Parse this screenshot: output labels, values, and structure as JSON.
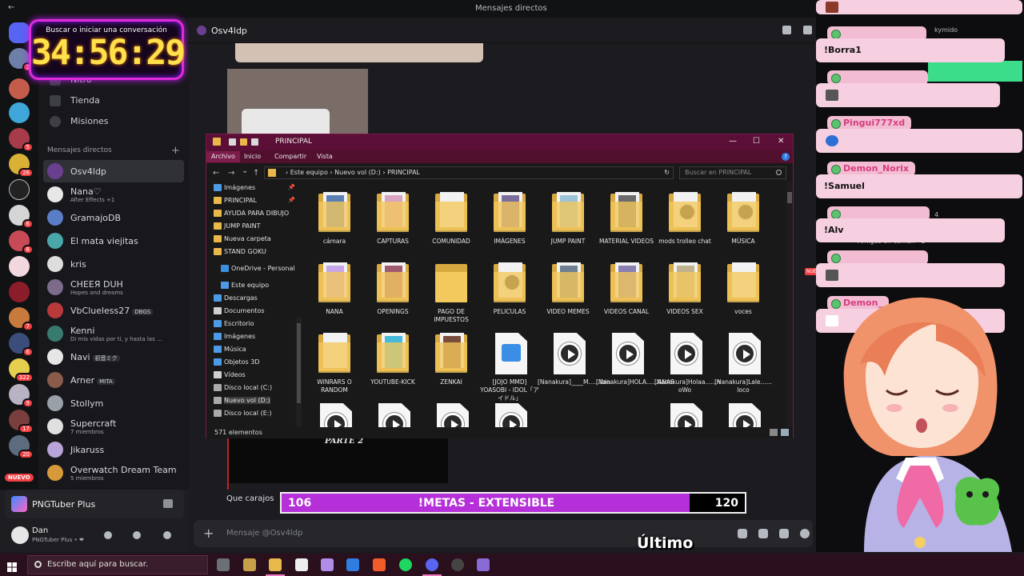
{
  "window": {
    "title": "Mensajes directos",
    "back_glyph": "←"
  },
  "timer": {
    "label": "Buscar o iniciar una conversación",
    "value": "34:56:29"
  },
  "servers": {
    "badges": [
      {
        "label": "2"
      },
      {
        "label": "5"
      },
      {
        "label": "26"
      },
      {
        "label": "6"
      },
      {
        "label": "6"
      },
      {
        "label": "7"
      },
      {
        "label": "6"
      },
      {
        "label": "322"
      },
      {
        "label": "9"
      },
      {
        "label": "17"
      },
      {
        "label": "20"
      }
    ],
    "new_label": "NUEVO"
  },
  "dm_column": {
    "nav": [
      {
        "label": "Nitro"
      },
      {
        "label": "Tienda"
      },
      {
        "label": "Misiones"
      }
    ],
    "header": "Mensajes directos",
    "plus": "+",
    "dms": [
      {
        "name": "Osv4ldp",
        "sub": ""
      },
      {
        "name": "Nana♡",
        "sub": "After Effects +1"
      },
      {
        "name": "GramajoDB",
        "sub": ""
      },
      {
        "name": "El mata viejitas",
        "sub": ""
      },
      {
        "name": "kris",
        "sub": ""
      },
      {
        "name": "CHEEЯ DUH",
        "sub": "Hopes and dreams"
      },
      {
        "name": "VbClueless27",
        "sub": "",
        "tag": "DBGS"
      },
      {
        "name": "Kenni",
        "sub": "Di mis vidas por ti, y hasta las ..."
      },
      {
        "name": "Navi",
        "sub": "",
        "tag": "初音ミク"
      },
      {
        "name": "Arner",
        "sub": "",
        "tag": "MITA"
      },
      {
        "name": "Stollym",
        "sub": ""
      },
      {
        "name": "Supercraft",
        "sub": "7 miembros"
      },
      {
        "name": "Jikaruss",
        "sub": ""
      },
      {
        "name": "Overwatch Dream Team",
        "sub": "5 miembros"
      }
    ]
  },
  "app_panel": {
    "label": "PNGTuber Plus"
  },
  "user": {
    "name": "Dan",
    "status": "PNGTuber Plus • ❤"
  },
  "chat": {
    "channel": "Osv4ldp",
    "image_caption": "PARTE 2",
    "last_message": "Que carajos",
    "new_marker": "NUE",
    "input_placeholder": "Mensaje @Osv4ldp",
    "plus": "+"
  },
  "metas": {
    "start": "106",
    "label": "!METAS - EXTENSIBLE",
    "goal": "120",
    "progress_fraction": 0.88
  },
  "caption": "Último",
  "explorer": {
    "title": "PRINCIPAL",
    "window_controls": [
      "—",
      "☐",
      "✕"
    ],
    "ribbon": {
      "tabs": [
        "Archivo",
        "Inicio",
        "Compartir",
        "Vista"
      ],
      "help": "?"
    },
    "path": [
      "Este equipo",
      "Nuevo vol (D:)",
      "PRINCIPAL"
    ],
    "path_sep": "›",
    "search_placeholder": "Buscar en PRINCIPAL",
    "nav_glyphs": {
      "back": "←",
      "forward": "→",
      "down": "⌄",
      "up": "↑",
      "refresh": "↻"
    },
    "sidebar": [
      {
        "label": "Imágenes",
        "pinned": true
      },
      {
        "label": "PRINCIPAL",
        "pinned": true
      },
      {
        "label": "AYUDA PARA DIBUJO",
        "pinned": false
      },
      {
        "label": "JUMP PAINT",
        "pinned": false
      },
      {
        "label": "Nueva carpeta",
        "pinned": false
      },
      {
        "label": "STAND GOKU",
        "pinned": false
      },
      {
        "label": "OneDrive - Personal",
        "pinned": false
      },
      {
        "label": "Este equipo",
        "pinned": false
      },
      {
        "label": "Descargas",
        "pinned": false
      },
      {
        "label": "Documentos",
        "pinned": false
      },
      {
        "label": "Escritorio",
        "pinned": false
      },
      {
        "label": "Imágenes",
        "pinned": false
      },
      {
        "label": "Música",
        "pinned": false
      },
      {
        "label": "Objetos 3D",
        "pinned": false
      },
      {
        "label": "Vídeos",
        "pinned": false
      },
      {
        "label": "Disco local (C:)",
        "pinned": false
      },
      {
        "label": "Nuevo vol (D:)",
        "pinned": false
      },
      {
        "label": "Disco local (E:)",
        "pinned": false
      }
    ],
    "items": [
      {
        "label": "cámara",
        "kind": "folder-pic"
      },
      {
        "label": "CAPTURAS",
        "kind": "folder-pic"
      },
      {
        "label": "COMUNIDAD",
        "kind": "folder-doc"
      },
      {
        "label": "IMÁGENES",
        "kind": "folder-pic"
      },
      {
        "label": "JUMP PAINT",
        "kind": "folder-pic"
      },
      {
        "label": "MATERIAL VIDEOS",
        "kind": "folder-pic"
      },
      {
        "label": "mods trolleo chat",
        "kind": "folder-video"
      },
      {
        "label": "MÚSICA",
        "kind": "folder-video"
      },
      {
        "label": "NANA",
        "kind": "folder-pic"
      },
      {
        "label": "OPENINGS",
        "kind": "folder-pic"
      },
      {
        "label": "PAGO DE IMPUESTOS",
        "kind": "folder"
      },
      {
        "label": "PELICULAS",
        "kind": "folder-video"
      },
      {
        "label": "VIDEO MEMES",
        "kind": "folder-pic"
      },
      {
        "label": "VIDEOS CANAL",
        "kind": "folder-pic"
      },
      {
        "label": "VIDEOS SEX",
        "kind": "folder-pic"
      },
      {
        "label": "voces",
        "kind": "folder-doc"
      },
      {
        "label": "WINRARS O RANDOM",
        "kind": "folder-doc"
      },
      {
        "label": "YOUTUBE-KICK",
        "kind": "folder-pic"
      },
      {
        "label": "ZENKAI",
        "kind": "folder-pic"
      },
      {
        "label": "[JOJO MMD] YOASOBI - IDOL「アイドル」",
        "kind": "media"
      },
      {
        "label": "[Nanakura]____M......ibia.",
        "kind": "video"
      },
      {
        "label": "[Nanakura]HOLA......ANAS.",
        "kind": "video"
      },
      {
        "label": "[Nanakura]Holaa......n oWo",
        "kind": "video"
      },
      {
        "label": "[Nanakura]Lale...... loco",
        "kind": "video"
      }
    ],
    "status": "571 elementos"
  },
  "chat_overlay": [
    {
      "user": "",
      "text": "",
      "icon": true
    },
    {
      "user": "",
      "text": "!Borra1",
      "icon": false
    },
    {
      "user": "",
      "text": "",
      "icon": true
    },
    {
      "user": "Pingui777xd",
      "text": "",
      "icon": true
    },
    {
      "user": "Demon_Norix",
      "text": "!Samuel",
      "icon": false
    },
    {
      "user": "",
      "text": "!Alv",
      "icon": false
    },
    {
      "user": "",
      "text": "",
      "icon": true
    },
    {
      "user": "Demon_",
      "text": "",
      "icon": true
    }
  ],
  "overlay_glimpses": {
    "top_right": "kymido",
    "count": "4",
    "friends": "Amigos en común · 2"
  },
  "taskbar": {
    "search_placeholder": "Escribe aquí para buscar."
  },
  "colors": {
    "accent": "#b530d8",
    "timer_glow": "#e02bd8",
    "timer_digits": "#ffe14b",
    "chat_bubble": "#f6cfe0",
    "explorer_title": "#5b0f36"
  }
}
